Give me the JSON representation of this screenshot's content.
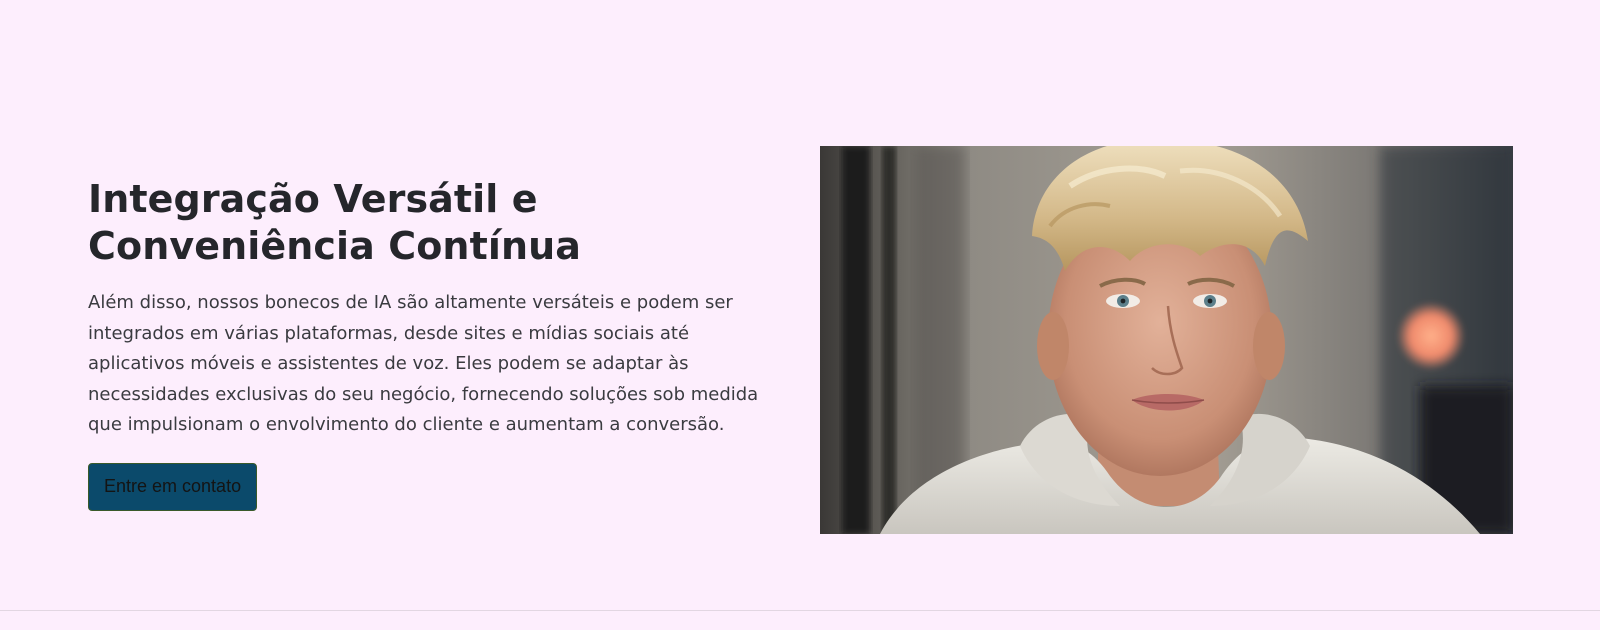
{
  "feature": {
    "heading": "Integração Versátil e Conveniência Contínua",
    "body": "Além disso, nossos bonecos de IA são altamente versáteis e podem ser integrados em várias plataformas, desde sites e mídias sociais até aplicativos móveis e assistentes de voz. Eles podem se adaptar às necessidades exclusivas do seu negócio, fornecendo soluções sob medida que impulsionam o envolvimento do cliente e aumentam a conversão.",
    "cta_label": "Entre em contato",
    "image_subject": "portrait-photo"
  },
  "colors": {
    "page_background": "#fdeefd",
    "heading_text": "#25262b",
    "body_text": "#3a3b40",
    "cta_background": "#0b4a6b"
  }
}
